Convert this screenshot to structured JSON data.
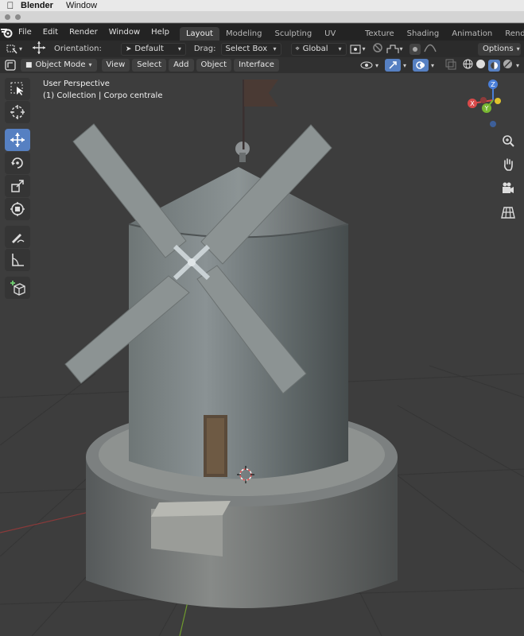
{
  "mac": {
    "app": "Blender",
    "menu_window": "Window"
  },
  "topbar": {
    "menus": [
      "File",
      "Edit",
      "Render",
      "Window",
      "Help"
    ],
    "tabs": [
      "Layout",
      "Modeling",
      "Sculpting",
      "UV Editing",
      "Texture Paint",
      "Shading",
      "Animation",
      "Rendering"
    ]
  },
  "toolsettings": {
    "orientation_label": "Orientation:",
    "orientation_value": "Default",
    "drag_label": "Drag:",
    "drag_value": "Select Box",
    "transform_orientation": "Global",
    "options_label": "Options"
  },
  "header": {
    "mode": "Object Mode",
    "menus": [
      "View",
      "Select",
      "Add",
      "Object",
      "Interface"
    ]
  },
  "overlay": {
    "view_name": "User Perspective",
    "collection_info": "(1) Collection | Corpo centrale"
  },
  "gizmo": {
    "x": "X",
    "y": "Y",
    "z": "Z"
  },
  "colors": {
    "accent": "#5680c2",
    "x_axis": "#d94a4a",
    "y_axis": "#79b832",
    "z_axis": "#4a7fd9"
  },
  "icons": {
    "toolbar": [
      "select-box-icon",
      "cursor-icon",
      "move-icon",
      "rotate-icon",
      "scale-icon",
      "transform-icon",
      "annotate-icon",
      "measure-icon",
      "add-cube-icon"
    ],
    "nav": [
      "zoom-icon",
      "pan-hand-icon",
      "camera-icon",
      "grid-view-icon"
    ]
  }
}
